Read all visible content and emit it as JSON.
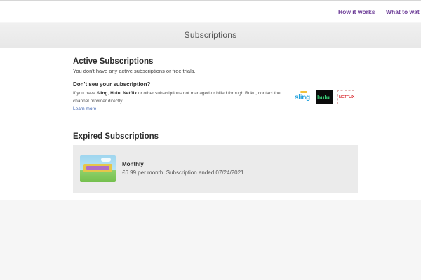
{
  "nav": {
    "how_it_works": "How it works",
    "what_to_watch": "What to wat"
  },
  "page": {
    "title": "Subscriptions"
  },
  "active": {
    "heading": "Active Subscriptions",
    "empty_message": "You don't have any active subscriptions or free trials.",
    "dont_see_heading": "Don't see your subscription?",
    "explain_prefix": "If you have ",
    "provider_sling": "Sling",
    "sep1": ", ",
    "provider_hulu": "Hulu",
    "sep2": ", ",
    "provider_netflix": "Netflix",
    "explain_suffix": " or other subscriptions not managed or billed through Roku, contact the channel provider directly.",
    "learn_more": "Learn more",
    "logos": {
      "sling": "sling",
      "hulu": "hulu",
      "netflix": "NETFLIX"
    }
  },
  "expired": {
    "heading": "Expired Subscriptions",
    "items": [
      {
        "thumbnail_icon": "channel-thumbnail-icon",
        "plan": "Monthly",
        "detail": "£6.99 per month. Subscription ended 07/24/2021"
      }
    ]
  },
  "colors": {
    "nav_link": "#6c3c97",
    "link": "#3b61b0",
    "sling": "#1fa0dc",
    "hulu": "#3ad27a",
    "netflix": "#d8232a",
    "card_bg": "#ebebeb"
  }
}
